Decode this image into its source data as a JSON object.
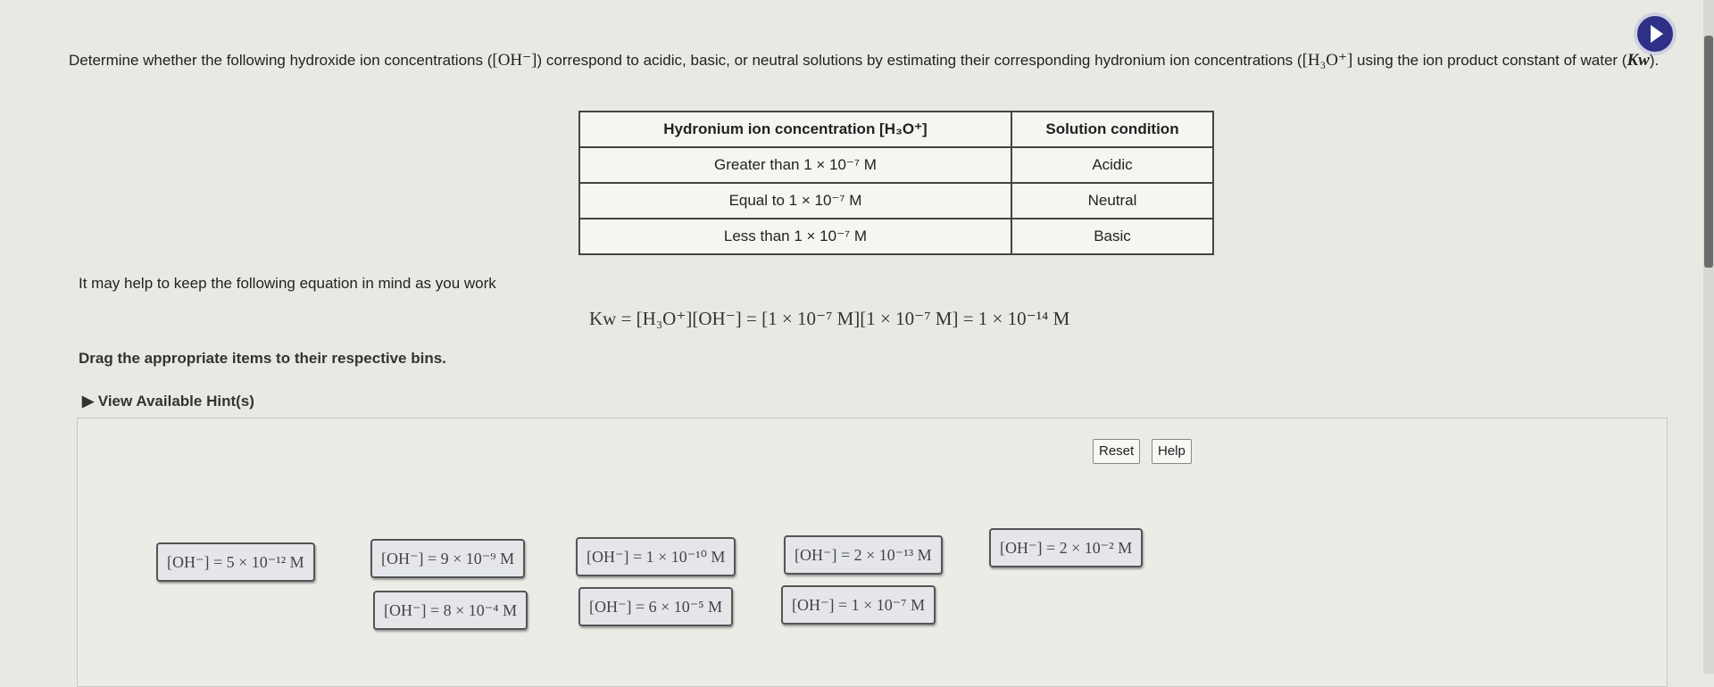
{
  "instructions": {
    "intro_part1": "Determine whether the following hydroxide ion concentrations (",
    "oh_symbol": "[OH⁻]",
    "intro_part2": ") correspond to acidic, basic, or neutral solutions by estimating their corresponding hydronium ion concentrations (",
    "h3o_symbol": "[H₃O⁺]",
    "intro_part3": " using the ion product constant of water (",
    "kw_symbol": "Kw",
    "intro_part4": ").",
    "help_text": "It may help to keep the following equation in mind as you work",
    "equation": "Kw = [H₃O⁺][OH⁻] = [1 × 10⁻⁷ M][1 × 10⁻⁷ M] = 1 × 10⁻¹⁴ M",
    "drag_text": "Drag the appropriate items to their respective bins.",
    "hint_label": "View Available Hint(s)"
  },
  "table": {
    "headers": [
      "Hydronium ion concentration [H₃O⁺]",
      "Solution condition"
    ],
    "rows": [
      [
        "Greater than 1 × 10⁻⁷ M",
        "Acidic"
      ],
      [
        "Equal to 1 × 10⁻⁷ M",
        "Neutral"
      ],
      [
        "Less than 1 × 10⁻⁷ M",
        "Basic"
      ]
    ]
  },
  "toolbar": {
    "reset_label": "Reset",
    "help_label": "Help"
  },
  "items": [
    "[OH⁻] = 5 × 10⁻¹² M",
    "[OH⁻] = 9 × 10⁻⁹ M",
    "[OH⁻] = 1 × 10⁻¹⁰ M",
    "[OH⁻] = 2 × 10⁻¹³ M",
    "[OH⁻] = 2 × 10⁻² M",
    "[OH⁻] = 8 × 10⁻⁴ M",
    "[OH⁻] = 6 × 10⁻⁵ M",
    "[OH⁻] = 1 × 10⁻⁷ M"
  ],
  "icons": {
    "play": "play-icon",
    "hint_toggle": "triangle-right-icon"
  },
  "colors": {
    "play_button": "#2e2f86"
  }
}
